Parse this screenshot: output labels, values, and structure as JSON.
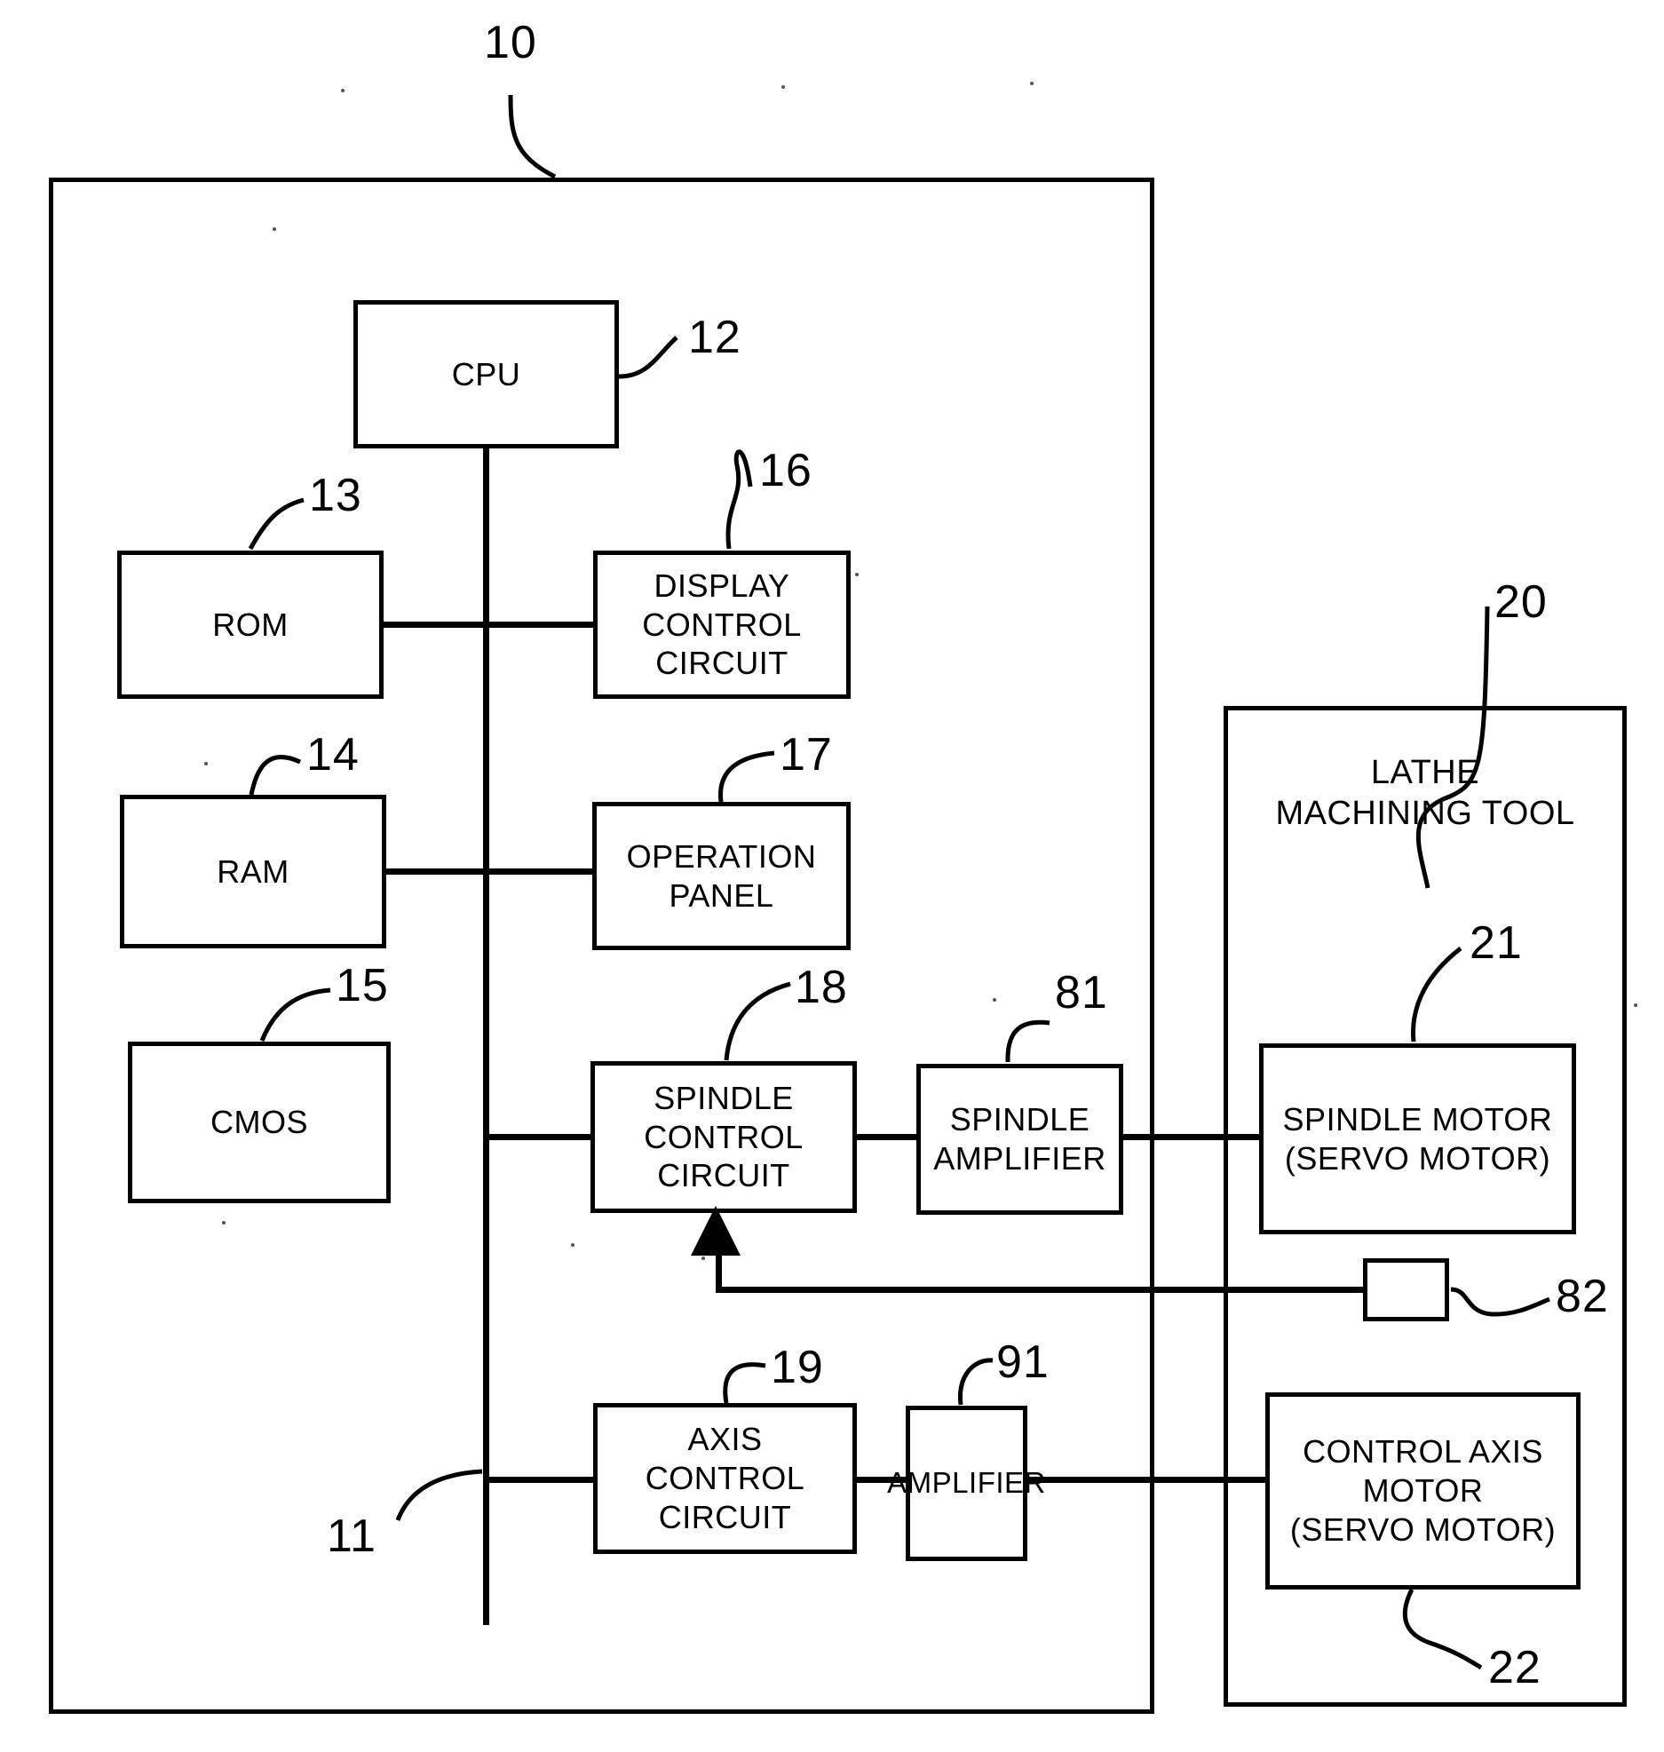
{
  "figure": {
    "type": "patent-block-diagram",
    "title": "CNC controller and lathe machining tool block diagram"
  },
  "containers": [
    {
      "id": "controller",
      "name": "numerical-controller",
      "label": "",
      "ref": "10"
    },
    {
      "id": "machine",
      "name": "lathe-machining-tool",
      "label": "LATHE\nMACHINING TOOL",
      "ref": "20"
    }
  ],
  "blocks": {
    "cpu": {
      "label": "CPU",
      "ref": "12"
    },
    "rom": {
      "label": "ROM",
      "ref": "13"
    },
    "ram": {
      "label": "RAM",
      "ref": "14"
    },
    "cmos": {
      "label": "CMOS",
      "ref": "15"
    },
    "display_control_circuit": {
      "label": "DISPLAY\nCONTROL\nCIRCUIT",
      "ref": "16"
    },
    "operation_panel": {
      "label": "OPERATION\nPANEL",
      "ref": "17"
    },
    "spindle_control_circuit": {
      "label": "SPINDLE\nCONTROL\nCIRCUIT",
      "ref": "18"
    },
    "spindle_amplifier": {
      "label": "SPINDLE\nAMPLIFIER",
      "ref": "81"
    },
    "axis_control_circuit": {
      "label": "AXIS\nCONTROL\nCIRCUIT",
      "ref": "19"
    },
    "amplifier": {
      "label": "AMPLIFIER",
      "ref": "91"
    },
    "spindle_motor": {
      "label": "SPINDLE MOTOR\n(SERVO MOTOR)",
      "ref": "21"
    },
    "position_detector": {
      "label": "",
      "ref": "82"
    },
    "control_axis_motor": {
      "label": "CONTROL AXIS\nMOTOR\n(SERVO MOTOR)",
      "ref": "22"
    }
  },
  "bus": {
    "name": "system-bus",
    "ref": "11"
  },
  "colors": {
    "line": "#000000",
    "background": "#ffffff"
  }
}
